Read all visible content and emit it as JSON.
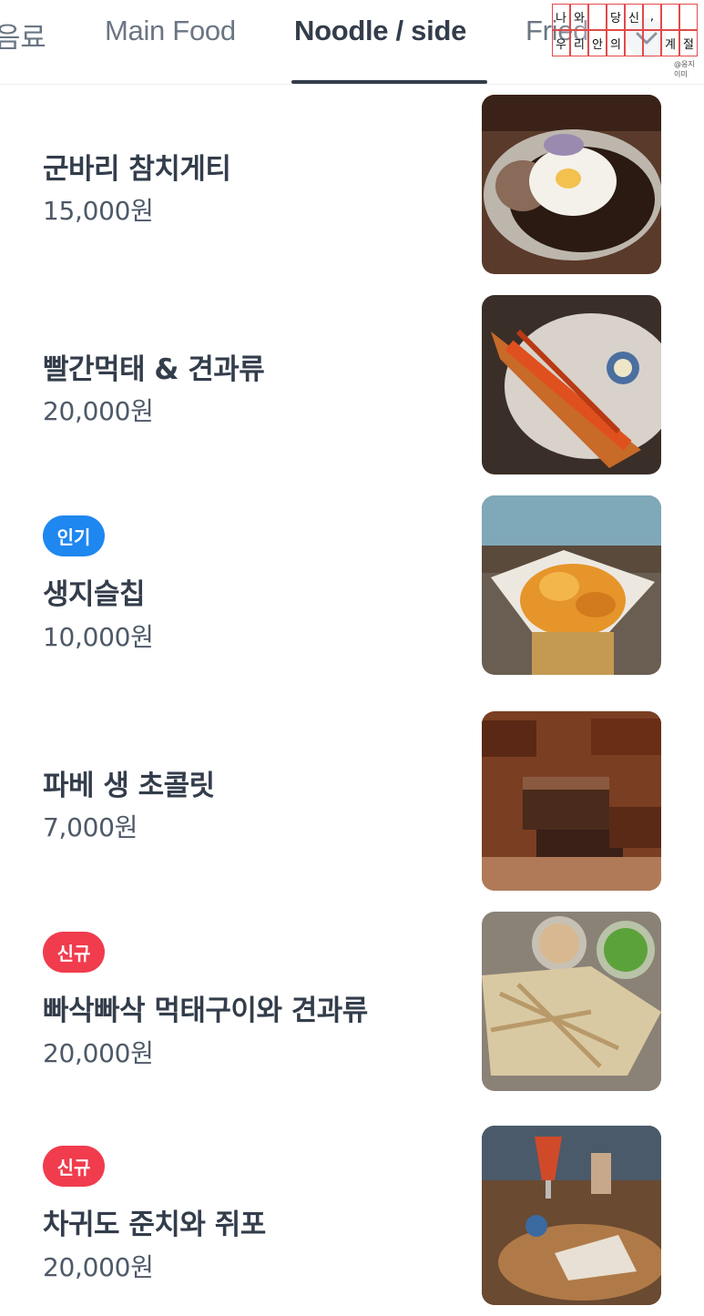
{
  "tabs": [
    {
      "label": "음료",
      "active": false
    },
    {
      "label": "Main Food",
      "active": false
    },
    {
      "label": "Noodle / side",
      "active": true
    },
    {
      "label": "Fried",
      "active": false
    }
  ],
  "stamp": {
    "row1": [
      "나",
      "와",
      "",
      "당",
      "신",
      ",",
      "",
      ""
    ],
    "row2": [
      "우",
      "리",
      "안",
      "의",
      "",
      "",
      "계",
      "절"
    ],
    "mark": "@응지이미"
  },
  "menu": [
    {
      "name": "군바리 참치게티",
      "price": "15,000원",
      "badge": null,
      "icon": "jjajang-noodle-fried-egg-photo"
    },
    {
      "name": "빨간먹태 & 견과류",
      "price": "20,000원",
      "badge": null,
      "icon": "grilled-red-pollock-photo"
    },
    {
      "name": "생지슬칩",
      "price": "10,000원",
      "badge": {
        "label": "인기",
        "color": "#1e87f0"
      },
      "icon": "potato-chips-photo"
    },
    {
      "name": "파베 생 초콜릿",
      "price": "7,000원",
      "badge": null,
      "icon": "cocoa-chocolate-cubes-photo"
    },
    {
      "name": "빠삭빠삭 먹태구이와 견과류",
      "price": "20,000원",
      "badge": {
        "label": "신규",
        "color": "#f03c4d"
      },
      "icon": "dried-pollock-and-nuts-photo"
    },
    {
      "name": "차귀도 준치와 쥐포",
      "price": "20,000원",
      "badge": {
        "label": "신규",
        "color": "#f03c4d"
      },
      "icon": "dried-fish-platter-with-beer-photo"
    }
  ]
}
